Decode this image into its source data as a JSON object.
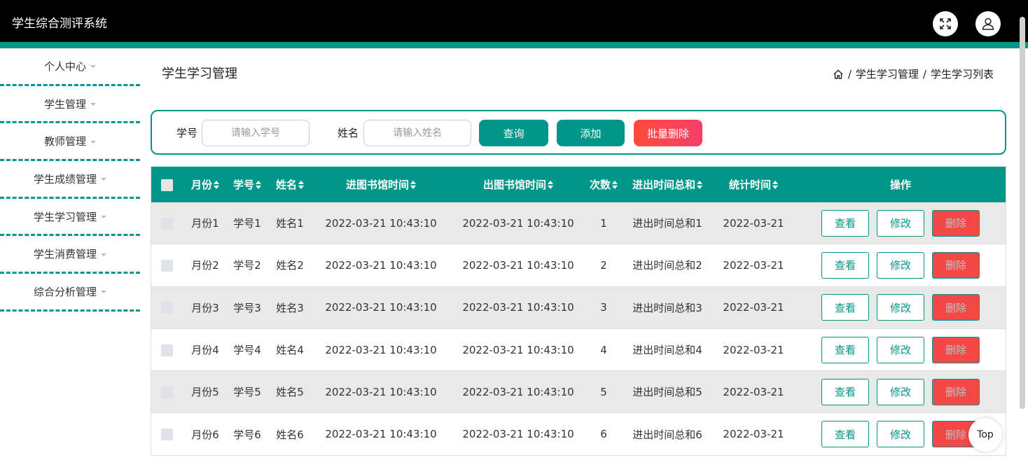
{
  "app": {
    "title": "学生综合测评系统",
    "fullscreen_icon": "expand-icon",
    "user_icon": "user-icon"
  },
  "sidebar": {
    "items": [
      {
        "label": "个人中心"
      },
      {
        "label": "学生管理"
      },
      {
        "label": "教师管理"
      },
      {
        "label": "学生成绩管理"
      },
      {
        "label": "学生学习管理"
      },
      {
        "label": "学生消费管理"
      },
      {
        "label": "综合分析管理"
      }
    ]
  },
  "page": {
    "title": "学生学习管理",
    "breadcrumb": {
      "home_icon": "home-icon",
      "sep1": "/",
      "level1": "学生学习管理",
      "sep2": "/",
      "level2": "学生学习列表"
    }
  },
  "search": {
    "id_label": "学号",
    "id_placeholder": "请输入学号",
    "name_label": "姓名",
    "name_placeholder": "请输入姓名",
    "query_label": "查询",
    "add_label": "添加",
    "batch_delete_label": "批量删除"
  },
  "table": {
    "headers": [
      "月份",
      "学号",
      "姓名",
      "进图书馆时间",
      "出图书馆时间",
      "次数",
      "进出时间总和",
      "统计时间",
      "操作"
    ],
    "rows": [
      {
        "month": "月份1",
        "id": "学号1",
        "name": "姓名1",
        "in_time": "2022-03-21 10:43:10",
        "out_time": "2022-03-21 10:43:10",
        "count": "1",
        "total": "进出时间总和1",
        "stat_date": "2022-03-21"
      },
      {
        "month": "月份2",
        "id": "学号2",
        "name": "姓名2",
        "in_time": "2022-03-21 10:43:10",
        "out_time": "2022-03-21 10:43:10",
        "count": "2",
        "total": "进出时间总和2",
        "stat_date": "2022-03-21"
      },
      {
        "month": "月份3",
        "id": "学号3",
        "name": "姓名3",
        "in_time": "2022-03-21 10:43:10",
        "out_time": "2022-03-21 10:43:10",
        "count": "3",
        "total": "进出时间总和3",
        "stat_date": "2022-03-21"
      },
      {
        "month": "月份4",
        "id": "学号4",
        "name": "姓名4",
        "in_time": "2022-03-21 10:43:10",
        "out_time": "2022-03-21 10:43:10",
        "count": "4",
        "total": "进出时间总和4",
        "stat_date": "2022-03-21"
      },
      {
        "month": "月份5",
        "id": "学号5",
        "name": "姓名5",
        "in_time": "2022-03-21 10:43:10",
        "out_time": "2022-03-21 10:43:10",
        "count": "5",
        "total": "进出时间总和5",
        "stat_date": "2022-03-21"
      },
      {
        "month": "月份6",
        "id": "学号6",
        "name": "姓名6",
        "in_time": "2022-03-21 10:43:10",
        "out_time": "2022-03-21 10:43:10",
        "count": "6",
        "total": "进出时间总和6",
        "stat_date": "2022-03-21"
      }
    ],
    "actions": {
      "view": "查看",
      "edit": "修改",
      "delete": "删除"
    }
  },
  "back_to_top": "Top",
  "colors": {
    "accent": "#00968a",
    "danger": "#f44848",
    "topbar": "#000000"
  }
}
